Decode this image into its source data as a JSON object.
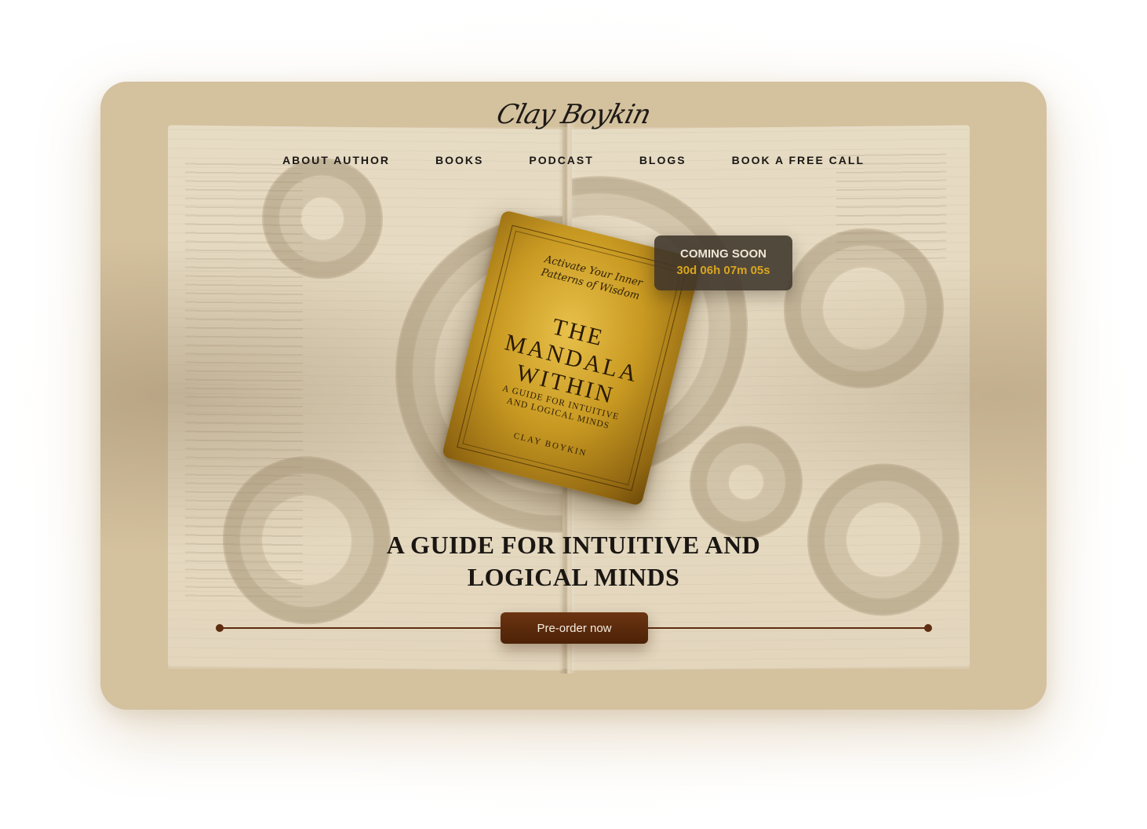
{
  "header": {
    "logo_text": "Clay Boykin",
    "nav": [
      {
        "label": "ABOUT AUTHOR"
      },
      {
        "label": "BOOKS"
      },
      {
        "label": "PODCAST"
      },
      {
        "label": "BLOGS"
      },
      {
        "label": "BOOK A FREE CALL"
      }
    ]
  },
  "book": {
    "tagline": "Activate Your Inner Patterns of Wisdom",
    "title": "THE MANDALA WITHIN",
    "subtitle": "A GUIDE FOR INTUITIVE AND LOGICAL MINDS",
    "author": "CLAY BOYKIN"
  },
  "countdown": {
    "label": "COMING SOON",
    "timer": "30d 06h 07m 05s"
  },
  "hero": {
    "headline": "A GUIDE FOR INTUITIVE AND LOGICAL MINDS",
    "cta_label": "Pre-order now"
  },
  "colors": {
    "card_background": "#d4c19e",
    "cta_background": "#5e2c10",
    "timer_accent": "#d9a51f",
    "countdown_panel": "#3e342a"
  },
  "icons": [
    "logo-signature-icon"
  ]
}
